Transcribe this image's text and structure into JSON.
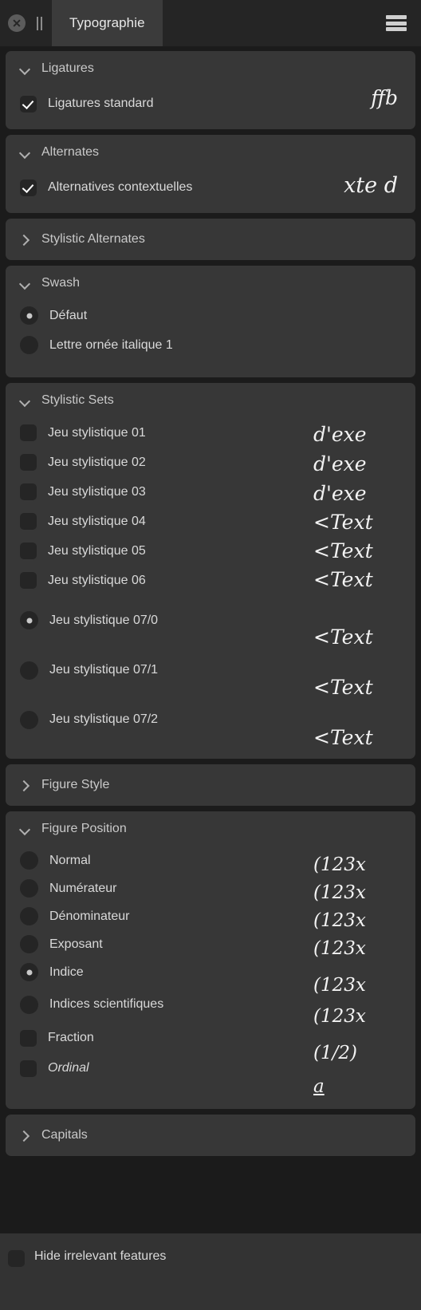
{
  "titlebar": {
    "close_label": "close-window",
    "pause_label": "pause",
    "tab_label": "Typographie",
    "menu_label": "menu"
  },
  "sections": {
    "ligatures": {
      "title": "Ligatures",
      "expanded": true,
      "items": [
        {
          "label": "Ligatures standard",
          "control": "checkbox",
          "checked": true,
          "sample": "ffb"
        }
      ]
    },
    "alternates": {
      "title": "Alternates",
      "expanded": true,
      "items": [
        {
          "label": "Alternatives contextuelles",
          "control": "checkbox",
          "checked": true,
          "sample": "xte d"
        }
      ]
    },
    "stylistic_alternates": {
      "title": "Stylistic Alternates",
      "expanded": false,
      "items": []
    },
    "swash": {
      "title": "Swash",
      "expanded": true,
      "items": [
        {
          "label": "Défaut",
          "control": "radio",
          "selected": true,
          "sample": ""
        },
        {
          "label": "Lettre ornée italique 1",
          "control": "radio",
          "selected": false,
          "sample": ""
        }
      ]
    },
    "stylistic_sets": {
      "title": "Stylistic Sets",
      "expanded": true,
      "items": [
        {
          "label": "Jeu stylistique 01",
          "control": "checkbox",
          "checked": false
        },
        {
          "label": "Jeu stylistique 02",
          "control": "checkbox",
          "checked": false
        },
        {
          "label": "Jeu stylistique 03",
          "control": "checkbox",
          "checked": false
        },
        {
          "label": "Jeu stylistique 04",
          "control": "checkbox",
          "checked": false
        },
        {
          "label": "Jeu stylistique 05",
          "control": "checkbox",
          "checked": false
        },
        {
          "label": "Jeu stylistique 06",
          "control": "checkbox",
          "checked": false
        },
        {
          "label": "Jeu stylistique 07/0",
          "control": "radio",
          "selected": true
        },
        {
          "label": "Jeu stylistique 07/1",
          "control": "radio",
          "selected": false
        },
        {
          "label": "Jeu stylistique 07/2",
          "control": "radio",
          "selected": false
        }
      ],
      "samples": [
        "d'exe",
        "d'exe",
        "d'exe",
        "<Text",
        "<Text",
        "<Text",
        "<Text",
        "<Text",
        "<Text"
      ]
    },
    "figure_style": {
      "title": "Figure Style",
      "expanded": false,
      "items": []
    },
    "figure_position": {
      "title": "Figure Position",
      "expanded": true,
      "items": [
        {
          "label": "Normal",
          "control": "radio",
          "selected": false
        },
        {
          "label": "Numérateur",
          "control": "radio",
          "selected": false
        },
        {
          "label": "Dénominateur",
          "control": "radio",
          "selected": false
        },
        {
          "label": "Exposant",
          "control": "radio",
          "selected": false
        },
        {
          "label": "Indice",
          "control": "radio",
          "selected": true
        },
        {
          "label": "Indices scientifiques",
          "control": "radio",
          "selected": false
        },
        {
          "label": "Fraction",
          "control": "checkbox",
          "checked": false
        },
        {
          "label": "Ordinal",
          "control": "checkbox",
          "checked": false,
          "italic": true
        }
      ],
      "samples": [
        "(123x",
        "(123x",
        "(123x",
        "(123x",
        "(123x",
        "(123x",
        "(1/2)",
        "a"
      ]
    },
    "capitals": {
      "title": "Capitals",
      "expanded": false,
      "items": []
    }
  },
  "footer": {
    "hide_irrelevant_label": "Hide irrelevant features",
    "hide_irrelevant_checked": false
  },
  "colors": {
    "window_bg": "#1b1b1b",
    "titlebar_bg": "#252525",
    "card_bg": "#373737",
    "tab_bg": "#3b3b3b",
    "text": "#d9d9d9",
    "muted_text": "#c9c9c9",
    "control_bg": "#252525",
    "accent_dot": "#c9c9c9"
  }
}
